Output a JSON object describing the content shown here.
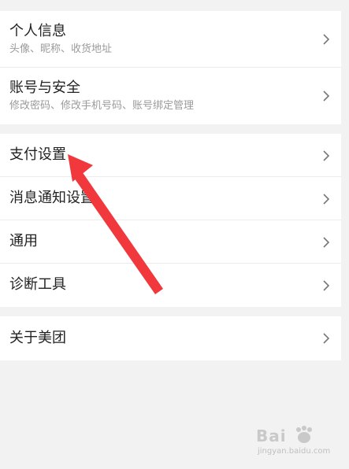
{
  "groups": [
    {
      "items": [
        {
          "title": "个人信息",
          "subtitle": "头像、昵称、收货地址"
        },
        {
          "title": "账号与安全",
          "subtitle": "修改密码、修改手机号码、账号绑定管理"
        }
      ]
    },
    {
      "items": [
        {
          "title": "支付设置"
        },
        {
          "title": "消息通知设置"
        },
        {
          "title": "通用"
        },
        {
          "title": "诊断工具"
        }
      ]
    },
    {
      "items": [
        {
          "title": "关于美团"
        }
      ]
    }
  ],
  "colors": {
    "background": "#f2f2f2",
    "card": "#ffffff",
    "title_text": "#222222",
    "subtitle_text": "#9a9a9a",
    "chevron": "#777777",
    "annotation_arrow": "#f0383d"
  },
  "icons": {
    "chevron": "chevron-right-icon"
  },
  "watermark": {
    "logo": "Bai",
    "site": "jingyan.baidu.com"
  }
}
